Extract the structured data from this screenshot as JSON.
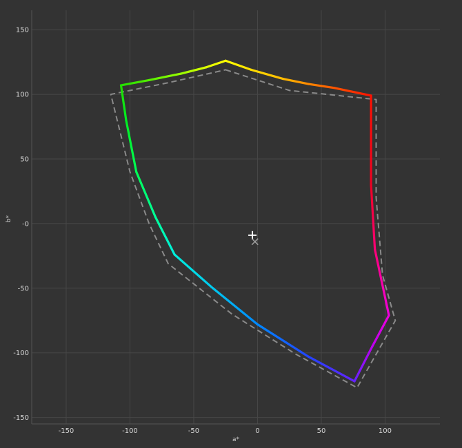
{
  "chart_data": {
    "type": "line",
    "title": "",
    "xlabel": "a*",
    "ylabel": "b*",
    "xlim": [
      -177,
      143
    ],
    "ylim": [
      -155,
      165
    ],
    "xticks": [
      -150,
      -100,
      -50,
      0,
      50,
      100
    ],
    "yticks": [
      -150,
      -100,
      -50,
      0,
      50,
      100,
      150
    ],
    "xtick_labels": [
      "-150",
      "-100",
      "-50",
      "0",
      "50",
      "100"
    ],
    "ytick_labels": [
      "-150",
      "-100",
      "-50",
      "-0",
      "50",
      "100",
      "150"
    ],
    "grid": true,
    "background": "#333333",
    "grid_color": "#474747",
    "series": [
      {
        "style": "rainbow-solid",
        "closed": true,
        "points": [
          {
            "a": -25,
            "b": 126,
            "color": "#ffff00"
          },
          {
            "a": -5,
            "b": 119,
            "color": "#ffdd00"
          },
          {
            "a": 20,
            "b": 112,
            "color": "#ffbb00"
          },
          {
            "a": 40,
            "b": 108,
            "color": "#ff8800"
          },
          {
            "a": 60,
            "b": 105,
            "color": "#ff5500"
          },
          {
            "a": 89,
            "b": 99,
            "color": "#ff1100"
          },
          {
            "a": 89,
            "b": 30,
            "color": "#ee0022"
          },
          {
            "a": 92,
            "b": -20,
            "color": "#ff0077"
          },
          {
            "a": 103,
            "b": -71,
            "color": "#ee00dd"
          },
          {
            "a": 90,
            "b": -95,
            "color": "#bb00ee"
          },
          {
            "a": 76,
            "b": -122,
            "color": "#6622ff"
          },
          {
            "a": 40,
            "b": -103,
            "color": "#2244ff"
          },
          {
            "a": 0,
            "b": -78,
            "color": "#0088ff"
          },
          {
            "a": -35,
            "b": -50,
            "color": "#00c8ee"
          },
          {
            "a": -65,
            "b": -24,
            "color": "#00eedd"
          },
          {
            "a": -80,
            "b": 5,
            "color": "#00ff99"
          },
          {
            "a": -95,
            "b": 40,
            "color": "#00ff55"
          },
          {
            "a": -103,
            "b": 80,
            "color": "#00ee22"
          },
          {
            "a": -107,
            "b": 107,
            "color": "#22dd00"
          },
          {
            "a": -85,
            "b": 111,
            "color": "#55ee00"
          },
          {
            "a": -60,
            "b": 116,
            "color": "#99ff00"
          },
          {
            "a": -40,
            "b": 121,
            "color": "#ddff00"
          }
        ]
      },
      {
        "style": "gray-dashed",
        "closed": true,
        "color": "#8a8a8a",
        "points": [
          {
            "a": -25,
            "b": 119
          },
          {
            "a": 25,
            "b": 103
          },
          {
            "a": 93,
            "b": 96
          },
          {
            "a": 93,
            "b": 20
          },
          {
            "a": 98,
            "b": -40
          },
          {
            "a": 108,
            "b": -75
          },
          {
            "a": 78,
            "b": -127
          },
          {
            "a": 30,
            "b": -101
          },
          {
            "a": -20,
            "b": -70
          },
          {
            "a": -70,
            "b": -31
          },
          {
            "a": -85,
            "b": 0
          },
          {
            "a": -100,
            "b": 40
          },
          {
            "a": -115,
            "b": 100
          },
          {
            "a": -70,
            "b": 109
          }
        ]
      }
    ],
    "markers": [
      {
        "name": "white-point-plus",
        "symbol": "+",
        "a": -4,
        "b": -9,
        "color": "#ffffff"
      },
      {
        "name": "reference-point-x",
        "symbol": "x",
        "a": -2,
        "b": -14,
        "color": "#9a9a9a"
      }
    ]
  }
}
